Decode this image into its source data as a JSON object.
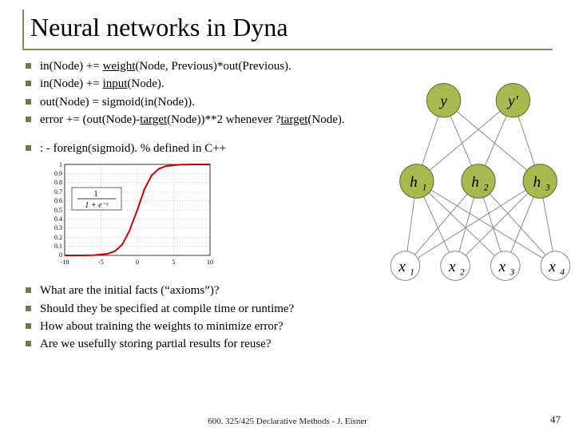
{
  "title": "Neural networks in Dyna",
  "bullets_top": [
    {
      "pre": "in(Node) += ",
      "u": "weight",
      "post": "(Node, Previous)*out(Previous)."
    },
    {
      "pre": "in(Node) += ",
      "u": "input",
      "post": "(Node)."
    },
    {
      "pre": "out(Node) = sigmoid(in(Node)).",
      "u": "",
      "post": ""
    },
    {
      "pre": "error += (out(Node)-",
      "u": "target",
      "post": "(Node))**2 whenever ?",
      "u2": "target",
      "post2": "(Node)."
    }
  ],
  "bullet_mid": ": - foreign(sigmoid). % defined in C++",
  "bullets_bottom": [
    "What are the initial facts (“axioms”)?",
    "Should they be specified at compile time or runtime?",
    "How about training the weights to minimize error?",
    "Are we usefully storing partial results for reuse?"
  ],
  "footer": "600. 325/425 Declarative Methods - J. Eisner",
  "page": "47",
  "chart_data": {
    "type": "line",
    "title": "",
    "xlabel": "",
    "ylabel": "",
    "xlim": [
      -10,
      10
    ],
    "ylim": [
      0,
      1
    ],
    "x_ticks": [
      -10,
      -5,
      0,
      5,
      10
    ],
    "y_ticks": [
      0,
      0.1,
      0.2,
      0.3,
      0.4,
      0.5,
      0.6,
      0.7,
      0.8,
      0.9,
      1
    ],
    "annotation": "1 / (1 + e^{-x})",
    "x": [
      -10,
      -8,
      -6,
      -4,
      -3,
      -2,
      -1,
      0,
      1,
      2,
      3,
      4,
      6,
      8,
      10
    ],
    "y": [
      5e-05,
      0.00034,
      0.00247,
      0.018,
      0.047,
      0.119,
      0.269,
      0.5,
      0.731,
      0.881,
      0.953,
      0.982,
      0.998,
      0.9997,
      0.99995
    ]
  },
  "nn": {
    "outputs": [
      "y",
      "y'"
    ],
    "hidden": [
      "h",
      "h",
      "h"
    ],
    "hidden_sub": [
      "1",
      "2",
      "3"
    ],
    "inputs": [
      "x",
      "x",
      "x",
      "x"
    ],
    "inputs_sub": [
      "1",
      "2",
      "3",
      "4"
    ]
  }
}
